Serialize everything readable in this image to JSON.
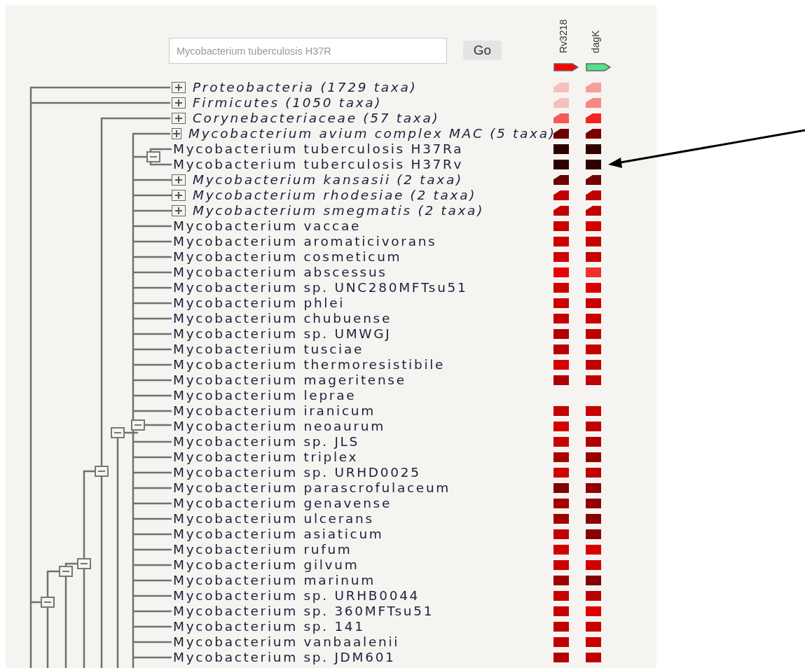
{
  "search": {
    "placeholder": "Mycobacterium tuberculosis H37R"
  },
  "go_button": "Go",
  "genes": [
    {
      "name": "Rv3218",
      "color": "#ff0000"
    },
    {
      "name": "dagK",
      "color": "#55e08a"
    }
  ],
  "rows": [
    {
      "kind": "group",
      "label": "Proteobacteria (1729 taxa)",
      "cells": [
        {
          "color": "#f7c0bc"
        },
        {
          "color": "#f6a09a"
        }
      ]
    },
    {
      "kind": "group",
      "label": "Firmicutes (1050 taxa)",
      "cells": [
        {
          "color": "#f7c0bc"
        },
        {
          "color": "#f58a82"
        }
      ]
    },
    {
      "kind": "group",
      "label": "Corynebacteriaceae (57 taxa)",
      "cells": [
        {
          "color": "#f65a55"
        },
        {
          "color": "#f42222"
        }
      ]
    },
    {
      "kind": "group",
      "label": "Mycobacterium avium complex MAC (5 taxa)",
      "cells": [
        {
          "color": "#6f0000"
        },
        {
          "color": "#7a0000"
        }
      ]
    },
    {
      "kind": "leaf",
      "label": "Mycobacterium tuberculosis H37Ra",
      "cells": [
        {
          "color": "#2e0000"
        },
        {
          "color": "#320000"
        }
      ]
    },
    {
      "kind": "leaf",
      "label": "Mycobacterium tuberculosis H37Rv",
      "cells": [
        {
          "color": "#2a0000"
        },
        {
          "color": "#2e0000"
        }
      ]
    },
    {
      "kind": "group",
      "label": "Mycobacterium kansasii (2 taxa)",
      "cells": [
        {
          "color": "#6a0000"
        },
        {
          "color": "#720000"
        }
      ]
    },
    {
      "kind": "group",
      "label": "Mycobacterium rhodesiae (2 taxa)",
      "cells": [
        {
          "color": "#c00000"
        },
        {
          "color": "#c00000"
        }
      ]
    },
    {
      "kind": "group",
      "label": "Mycobacterium smegmatis (2 taxa)",
      "cells": [
        {
          "color": "#c00000"
        },
        {
          "color": "#c00000"
        }
      ]
    },
    {
      "kind": "leaf",
      "label": "Mycobacterium vaccae",
      "cells": [
        {
          "color": "#c80000"
        },
        {
          "color": "#d40000"
        }
      ]
    },
    {
      "kind": "leaf",
      "label": "Mycobacterium aromaticivorans",
      "cells": [
        {
          "color": "#cc0000"
        },
        {
          "color": "#c40000"
        }
      ]
    },
    {
      "kind": "leaf",
      "label": "Mycobacterium cosmeticum",
      "cells": [
        {
          "color": "#d00000"
        },
        {
          "color": "#c80000"
        }
      ]
    },
    {
      "kind": "leaf",
      "label": "Mycobacterium abscessus",
      "cells": [
        {
          "color": "#e80000"
        },
        {
          "color": "#f03030"
        }
      ]
    },
    {
      "kind": "leaf",
      "label": "Mycobacterium sp. UNC280MFTsu51",
      "cells": [
        {
          "color": "#d00000"
        },
        {
          "color": "#d80000"
        }
      ]
    },
    {
      "kind": "leaf",
      "label": "Mycobacterium phlei",
      "cells": [
        {
          "color": "#c80000"
        },
        {
          "color": "#c80000"
        }
      ]
    },
    {
      "kind": "leaf",
      "label": "Mycobacterium chubuense",
      "cells": [
        {
          "color": "#c40000"
        },
        {
          "color": "#c80000"
        }
      ]
    },
    {
      "kind": "leaf",
      "label": "Mycobacterium sp. UMWGJ",
      "cells": [
        {
          "color": "#b00000"
        },
        {
          "color": "#c00000"
        }
      ]
    },
    {
      "kind": "leaf",
      "label": "Mycobacterium tusciae",
      "cells": [
        {
          "color": "#b80000"
        },
        {
          "color": "#c80000"
        }
      ]
    },
    {
      "kind": "leaf",
      "label": "Mycobacterium thermoresistibile",
      "cells": [
        {
          "color": "#d80000"
        },
        {
          "color": "#c00000"
        }
      ]
    },
    {
      "kind": "leaf",
      "label": "Mycobacterium mageritense",
      "cells": [
        {
          "color": "#ac0000"
        },
        {
          "color": "#c00000"
        }
      ]
    },
    {
      "kind": "leaf",
      "label": "Mycobacterium leprae"
    },
    {
      "kind": "leaf",
      "label": "Mycobacterium iranicum",
      "cells": [
        {
          "color": "#c40000"
        },
        {
          "color": "#c80000"
        }
      ]
    },
    {
      "kind": "leaf",
      "label": "Mycobacterium neoaurum",
      "cells": [
        {
          "color": "#d40000"
        },
        {
          "color": "#c00000"
        }
      ]
    },
    {
      "kind": "leaf",
      "label": "Mycobacterium sp. JLS",
      "cells": [
        {
          "color": "#c80000"
        },
        {
          "color": "#b00000"
        }
      ]
    },
    {
      "kind": "leaf",
      "label": "Mycobacterium triplex",
      "cells": [
        {
          "color": "#a80000"
        },
        {
          "color": "#980000"
        }
      ]
    },
    {
      "kind": "leaf",
      "label": "Mycobacterium sp. URHD0025",
      "cells": [
        {
          "color": "#d00000"
        },
        {
          "color": "#c00000"
        }
      ]
    },
    {
      "kind": "leaf",
      "label": "Mycobacterium parascrofulaceum",
      "cells": [
        {
          "color": "#800000"
        },
        {
          "color": "#900000"
        }
      ]
    },
    {
      "kind": "leaf",
      "label": "Mycobacterium genavense",
      "cells": [
        {
          "color": "#a40000"
        },
        {
          "color": "#900000"
        }
      ]
    },
    {
      "kind": "leaf",
      "label": "Mycobacterium ulcerans",
      "cells": [
        {
          "color": "#a00000"
        },
        {
          "color": "#880000"
        }
      ]
    },
    {
      "kind": "leaf",
      "label": "Mycobacterium asiaticum",
      "cells": [
        {
          "color": "#c00000"
        },
        {
          "color": "#880000"
        }
      ]
    },
    {
      "kind": "leaf",
      "label": "Mycobacterium rufum",
      "cells": [
        {
          "color": "#d00000"
        },
        {
          "color": "#d80000"
        }
      ]
    },
    {
      "kind": "leaf",
      "label": "Mycobacterium gilvum",
      "cells": [
        {
          "color": "#c80000"
        },
        {
          "color": "#d00000"
        }
      ]
    },
    {
      "kind": "leaf",
      "label": "Mycobacterium marinum",
      "cells": [
        {
          "color": "#9c0000"
        },
        {
          "color": "#800000"
        }
      ]
    },
    {
      "kind": "leaf",
      "label": "Mycobacterium sp. URHB0044",
      "cells": [
        {
          "color": "#c80000"
        },
        {
          "color": "#b80000"
        }
      ]
    },
    {
      "kind": "leaf",
      "label": "Mycobacterium sp. 360MFTsu51",
      "cells": [
        {
          "color": "#c80000"
        },
        {
          "color": "#e00000"
        }
      ]
    },
    {
      "kind": "leaf",
      "label": "Mycobacterium sp. 141",
      "cells": [
        {
          "color": "#c00000"
        },
        {
          "color": "#c80000"
        }
      ]
    },
    {
      "kind": "leaf",
      "label": "Mycobacterium vanbaalenii",
      "cells": [
        {
          "color": "#c00000"
        },
        {
          "color": "#c80000"
        }
      ]
    },
    {
      "kind": "leaf",
      "label": "Mycobacterium sp. JDM601",
      "cells": [
        {
          "color": "#b40000"
        },
        {
          "color": "#c00000"
        }
      ]
    }
  ]
}
